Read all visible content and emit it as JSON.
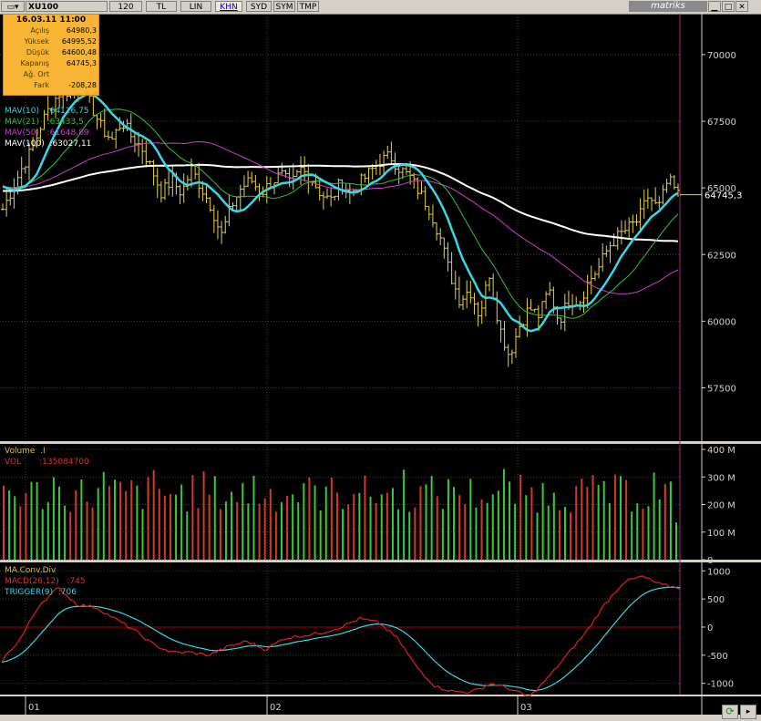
{
  "toolbar": {
    "symbol": "XU100",
    "buttons": [
      "120",
      "TL",
      "LIN",
      "KHN",
      "SYD",
      "SYM",
      "TMP"
    ],
    "active": "KHN",
    "brand": "matriks"
  },
  "info": {
    "date": "16.03.11 11:00",
    "rows": [
      {
        "label": "Açılış",
        "value": "64980,3"
      },
      {
        "label": "Yüksek",
        "value": "64995,52"
      },
      {
        "label": "Düşük",
        "value": "64600,48"
      },
      {
        "label": "Kapanış",
        "value": "64745,3"
      },
      {
        "label": "Ağ. Ort",
        "value": ""
      },
      {
        "label": "Fark",
        "value": "-208,28"
      }
    ]
  },
  "price_legend": [
    {
      "text": "MAV(10)   :64126,75",
      "color": "#39d6e6"
    },
    {
      "text": "MAV(21)   :63433,5",
      "color": "#34c134"
    },
    {
      "text": "MAV(50)   :61648,89",
      "color": "#d43ad4"
    },
    {
      "text": "MAV(100)  :63027,11",
      "color": "#ffffff"
    }
  ],
  "volume_legend": [
    {
      "text": "Volume  .I",
      "color": "#d9c43a"
    },
    {
      "text": "VOL       :135084700",
      "color": "#e23030"
    }
  ],
  "macd_legend": [
    {
      "text": "MA.Conv.Div",
      "color": "#d9c43a"
    },
    {
      "text": "MACD(26,12)   :745",
      "color": "#e23030"
    },
    {
      "text": "TRIGGER(9)  :706",
      "color": "#39d6e6"
    }
  ],
  "price_axis": [
    "70000",
    "67500",
    "65000",
    "62500",
    "60000",
    "57500"
  ],
  "last_price": "64745,3",
  "volume_axis": [
    "400 M",
    "300 M",
    "200 M",
    "100 M",
    "0"
  ],
  "macd_axis": [
    "1000",
    "500",
    "0",
    "-500",
    "-1000"
  ],
  "time_axis": [
    "01",
    "02",
    "03"
  ],
  "colors": {
    "price": "#e6d24a",
    "mav10": "#39d6e6",
    "mav21": "#34c134",
    "mav50": "#d43ad4",
    "mav100": "#ffffff",
    "vol_up": "#3cc83c",
    "vol_down": "#d23a2a",
    "macd": "#e02020",
    "trigger": "#39d6e6",
    "grid": "#2d4a2d",
    "zero": "#aa0000"
  },
  "chart_data": [
    {
      "type": "ohlc",
      "title": "XU100",
      "y_ticks": [
        57500,
        60000,
        62500,
        65000,
        67500,
        70000
      ],
      "ylim": [
        55500,
        71500
      ],
      "x_ticks": [
        "01",
        "02",
        "03"
      ],
      "close_path": [
        64200,
        65000,
        65800,
        66500,
        67500,
        68200,
        68700,
        68500,
        68800,
        68000,
        67200,
        66800,
        67500,
        66900,
        66500,
        65700,
        64800,
        65300,
        64800,
        65700,
        65000,
        64300,
        63200,
        64300,
        65000,
        65300,
        64800,
        65200,
        65500,
        65100,
        65700,
        65400,
        64800,
        64500,
        65200,
        64800,
        65200,
        65600,
        66000,
        66200,
        65700,
        65400,
        64800,
        64200,
        63200,
        61800,
        60800,
        61200,
        60200,
        61800,
        59800,
        58700,
        59800,
        60500,
        60200,
        61200,
        60000,
        60800,
        60700,
        61500,
        62000,
        62800,
        63200,
        63500,
        63800,
        64700,
        64200,
        65300,
        64745.3
      ]
    },
    {
      "type": "bar",
      "title": "Volume",
      "y_ticks": [
        0,
        100,
        200,
        300,
        400
      ],
      "ylim": [
        0,
        400
      ],
      "units": "M",
      "last": 135084700
    },
    {
      "type": "line",
      "title": "MA.Conv.Div",
      "series": [
        {
          "name": "MACD(26,12)",
          "last": 745
        },
        {
          "name": "TRIGGER(9)",
          "last": 706
        }
      ],
      "y_ticks": [
        -1000,
        -500,
        0,
        500,
        1000
      ],
      "ylim": [
        -1200,
        1150
      ]
    }
  ]
}
